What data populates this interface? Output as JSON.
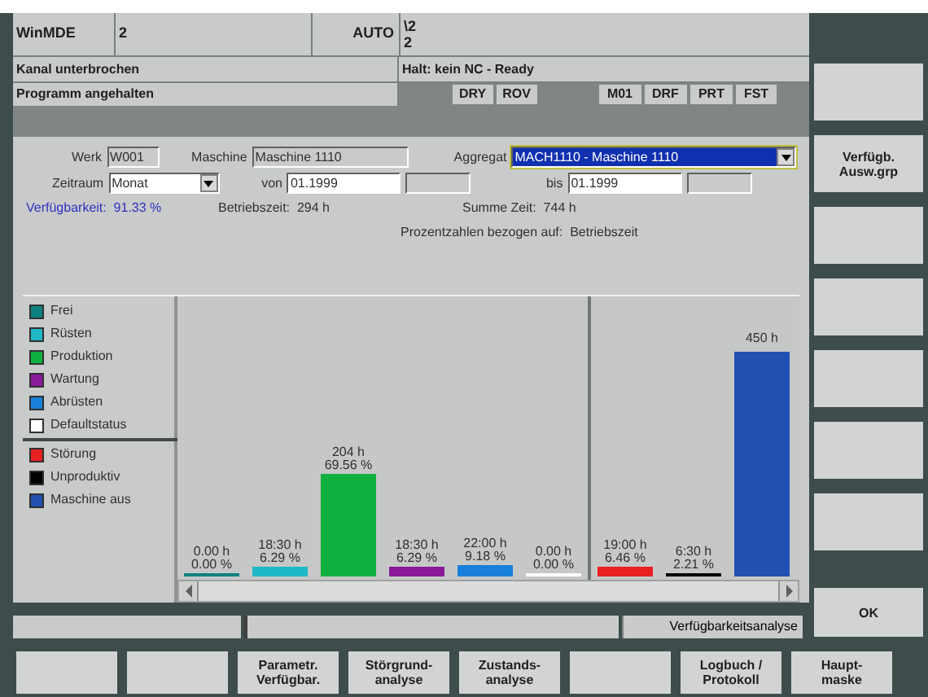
{
  "header": {
    "app": "WinMDE",
    "channel": "2",
    "mode": "AUTO",
    "program_lines": [
      "\\2",
      "2"
    ],
    "channel_state": "Kanal unterbrochen",
    "nc_state": "Halt: kein NC - Ready",
    "program_state": "Programm angehalten",
    "flags_left": [
      "DRY",
      "ROV"
    ],
    "flags_right": [
      "M01",
      "DRF",
      "PRT",
      "FST"
    ]
  },
  "form": {
    "werk_label": "Werk",
    "werk": "W001",
    "maschine_label": "Maschine",
    "maschine": "Maschine 1110",
    "aggregat_label": "Aggregat",
    "aggregat": "MACH1110 - Maschine 1110",
    "zeitraum_label": "Zeitraum",
    "zeitraum": "Monat",
    "von_label": "von",
    "von": "01.1999",
    "bis_label": "bis",
    "bis": "01.1999",
    "verfuegbarkeit": "Verfügbarkeit:  91.33 %",
    "betriebszeit": "Betriebszeit:  294 h",
    "summe": "Summe Zeit:  744 h",
    "prozent": "Prozentzahlen bezogen auf:  Betriebszeit"
  },
  "legend_groups": [
    {
      "items": [
        {
          "label": "Frei",
          "color": "#0f8080"
        },
        {
          "label": "Rüsten",
          "color": "#20b8c8"
        },
        {
          "label": "Produktion",
          "color": "#10b040"
        },
        {
          "label": "Wartung",
          "color": "#8a1a9a"
        },
        {
          "label": "Abrüsten",
          "color": "#1880d8"
        },
        {
          "label": "Defaultstatus",
          "color": "#ffffff"
        }
      ]
    },
    {
      "items": [
        {
          "label": "Störung",
          "color": "#e82020"
        },
        {
          "label": "Unproduktiv",
          "color": "#000000"
        },
        {
          "label": "Maschine aus",
          "color": "#2050b0"
        }
      ]
    }
  ],
  "chart": {
    "bar_groups": [
      {
        "bars": [
          {
            "hours": "0.00 h",
            "percent": "0.00 %",
            "color": "#0f8080"
          },
          {
            "hours": "18:30 h",
            "percent": "6.29 %",
            "color": "#20b8c8"
          },
          {
            "hours": "204 h",
            "percent": "69.56 %",
            "color": "#10b040"
          },
          {
            "hours": "18:30 h",
            "percent": "6.29 %",
            "color": "#8a1a9a"
          },
          {
            "hours": "22:00 h",
            "percent": "9.18 %",
            "color": "#1880d8"
          },
          {
            "hours": "0.00 h",
            "percent": "0.00 %",
            "color": "#ffffff"
          }
        ]
      },
      {
        "bars": [
          {
            "hours": "19:00 h",
            "percent": "6.46 %",
            "color": "#e82020"
          },
          {
            "hours": "6:30 h",
            "percent": "2.21 %",
            "color": "#000000"
          },
          {
            "hours": "450 h",
            "color": "#2050b0"
          }
        ]
      }
    ]
  },
  "status": {
    "message": "Verfügbarkeitsanalyse"
  },
  "vertical_softkeys": [
    {
      "kind": "blank"
    },
    {
      "kind": "labeled",
      "label": "Verfügb.\nAusw.grp"
    },
    {
      "kind": "blank"
    },
    {
      "kind": "blank"
    },
    {
      "kind": "blank"
    },
    {
      "kind": "blank"
    },
    {
      "kind": "blank"
    },
    {
      "kind": "labeled",
      "label": "OK"
    }
  ],
  "horizontal_softkeys": [
    {
      "kind": "blank"
    },
    {
      "kind": "blank"
    },
    {
      "kind": "labeled",
      "label": "Parametr.\nVerfügbar."
    },
    {
      "kind": "labeled",
      "label": "Störgrund-\nanalyse"
    },
    {
      "kind": "labeled",
      "label": "Zustands-\nanalyse"
    },
    {
      "kind": "blank"
    },
    {
      "kind": "labeled",
      "label": "Logbuch /\nProtokoll"
    },
    {
      "kind": "labeled",
      "label": "Haupt-\nmaske"
    }
  ]
}
